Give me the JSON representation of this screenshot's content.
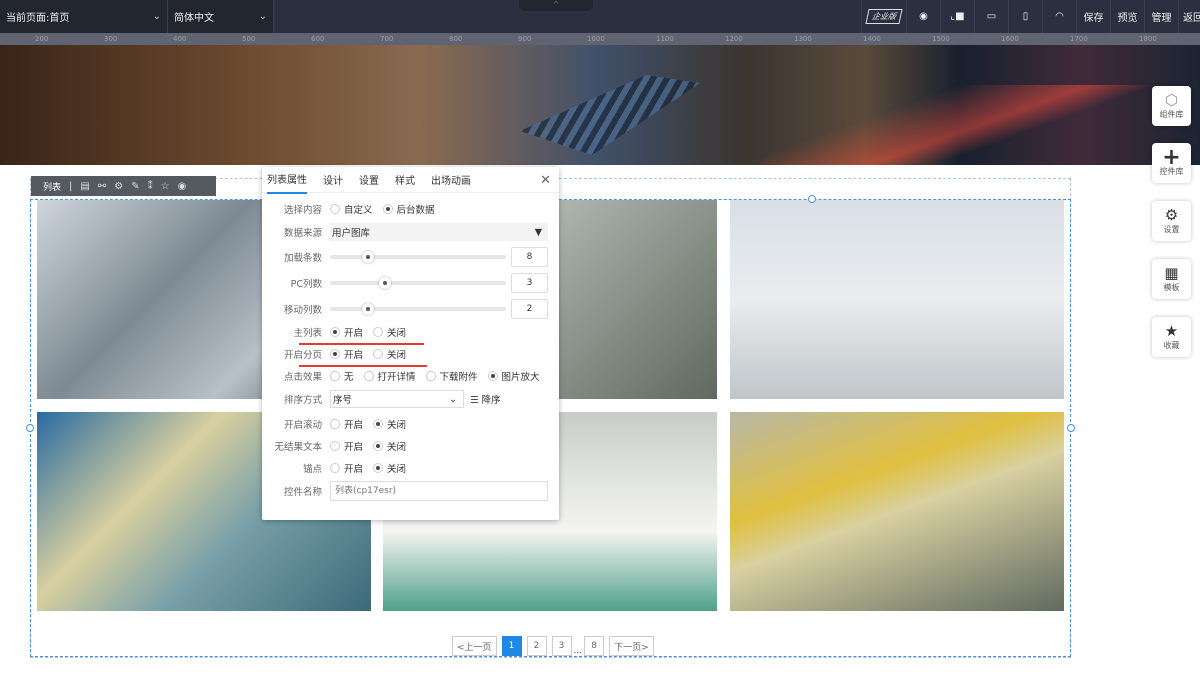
{
  "topbar": {
    "page_select": "当前页面:首页",
    "lang_select": "简体中文",
    "edition": "企业版",
    "save": "保存",
    "preview": "预览",
    "manage": "管理",
    "back": "返回"
  },
  "ruler": [
    "200",
    "300",
    "400",
    "500",
    "600",
    "700",
    "800",
    "900",
    "1000",
    "1100",
    "1200",
    "1300",
    "1400",
    "1500",
    "1600",
    "1700",
    "1800"
  ],
  "list_toolbar": {
    "label": "列表"
  },
  "panel": {
    "tabs": [
      "列表属性",
      "设计",
      "设置",
      "样式",
      "出场动画"
    ],
    "select_content": {
      "label": "选择内容",
      "options": [
        "自定义",
        "后台数据"
      ],
      "selected": 1
    },
    "data_source": {
      "label": "数据来源",
      "value": "用户图库"
    },
    "load_count": {
      "label": "加载条数",
      "value": "8"
    },
    "pc_cols": {
      "label": "PC列数",
      "value": "3"
    },
    "mobile_cols": {
      "label": "移动列数",
      "value": "2"
    },
    "main_list": {
      "label": "主列表",
      "options": [
        "开启",
        "关闭"
      ],
      "selected": 0
    },
    "paging": {
      "label": "开启分页",
      "options": [
        "开启",
        "关闭"
      ],
      "selected": 0
    },
    "click_effect": {
      "label": "点击效果",
      "options": [
        "无",
        "打开详情",
        "下载附件",
        "图片放大"
      ],
      "selected": 3
    },
    "sort": {
      "label": "排序方式",
      "value": "序号",
      "order": "降序"
    },
    "scroll": {
      "label": "开启滚动",
      "options": [
        "开启",
        "关闭"
      ],
      "selected": 1
    },
    "no_result": {
      "label": "无结果文本",
      "options": [
        "开启",
        "关闭"
      ],
      "selected": 1
    },
    "anchor": {
      "label": "锚点",
      "options": [
        "开启",
        "关闭"
      ],
      "selected": 1
    },
    "name": {
      "label": "控件名称",
      "placeholder": "列表(cp17esr)"
    }
  },
  "pager": {
    "prev": "<上一页",
    "pages": [
      "1",
      "2",
      "3",
      "8"
    ],
    "ellipsis": "...",
    "next": "下一页>",
    "current": "1"
  },
  "side": {
    "components": "组件库",
    "controls": "控件库",
    "settings": "设置",
    "templates": "模板",
    "favorites": "收藏"
  },
  "colors": {
    "accent": "#1e88e5",
    "highlight": "#e53935",
    "topbar": "#2b3040"
  }
}
